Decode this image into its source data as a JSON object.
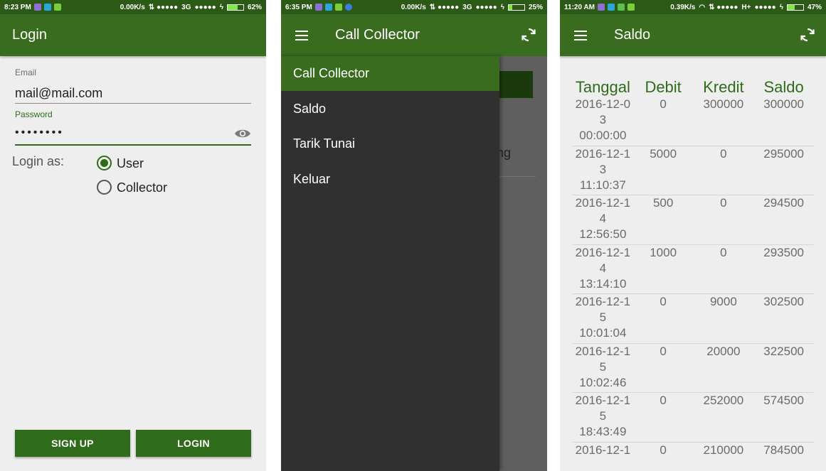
{
  "colors": {
    "status": "#2c5a16",
    "appbar": "#396c1f",
    "accent": "#2e6b1a",
    "drawer": "#303030"
  },
  "screen1": {
    "status": {
      "time": "8:23 PM",
      "net": "0.00K/s",
      "signal": "3G",
      "battery": "62%"
    },
    "appbar": {
      "title": "Login"
    },
    "email": {
      "label": "Email",
      "value": "mail@mail.com"
    },
    "password": {
      "label": "Password",
      "value": "••••••••",
      "toggle_icon": "eye-icon"
    },
    "login_as": {
      "label": "Login as:",
      "options": [
        {
          "label": "User",
          "selected": true
        },
        {
          "label": "Collector",
          "selected": false
        }
      ]
    },
    "buttons": {
      "signup": "SIGN UP",
      "login": "LOGIN"
    }
  },
  "screen2": {
    "status": {
      "time": "6:35 PM",
      "net": "0.00K/s",
      "signal": "3G",
      "battery": "25%"
    },
    "appbar": {
      "title": "Call Collector",
      "menu_icon": "hamburger-icon",
      "refresh_icon": "refresh-icon"
    },
    "background_text": "ng",
    "drawer": {
      "items": [
        "Call Collector",
        "Saldo",
        "Tarik Tunai",
        "Keluar"
      ],
      "selected_index": 0
    }
  },
  "screen3": {
    "status": {
      "time": "11:20 AM",
      "net": "0.39K/s",
      "signal": "H+",
      "battery": "47%"
    },
    "appbar": {
      "title": "Saldo",
      "menu_icon": "hamburger-icon",
      "refresh_icon": "refresh-icon"
    },
    "table": {
      "headers": {
        "date": "Tanggal",
        "debit": "Debit",
        "kredit": "Kredit",
        "saldo": "Saldo"
      },
      "rows": [
        {
          "date": "2016-12-0\n3\n00:00:00",
          "debit": "0",
          "kredit": "300000",
          "saldo": "300000"
        },
        {
          "date": "2016-12-1\n3\n11:10:37",
          "debit": "5000",
          "kredit": "0",
          "saldo": "295000"
        },
        {
          "date": "2016-12-1\n4\n12:56:50",
          "debit": "500",
          "kredit": "0",
          "saldo": "294500"
        },
        {
          "date": "2016-12-1\n4\n13:14:10",
          "debit": "1000",
          "kredit": "0",
          "saldo": "293500"
        },
        {
          "date": "2016-12-1\n5\n10:01:04",
          "debit": "0",
          "kredit": "9000",
          "saldo": "302500"
        },
        {
          "date": "2016-12-1\n5\n10:02:46",
          "debit": "0",
          "kredit": "20000",
          "saldo": "322500"
        },
        {
          "date": "2016-12-1\n5\n18:43:49",
          "debit": "0",
          "kredit": "252000",
          "saldo": "574500"
        },
        {
          "date": "2016-12-1",
          "debit": "0",
          "kredit": "210000",
          "saldo": "784500"
        }
      ]
    }
  }
}
